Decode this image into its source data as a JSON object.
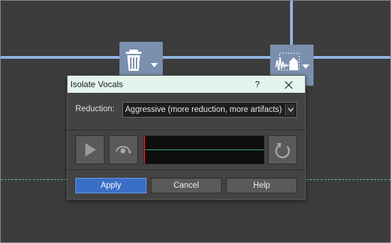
{
  "dialog": {
    "title": "Isolate Vocals",
    "help_glyph": "?",
    "close_icon": "close-icon"
  },
  "reduction": {
    "label": "Reduction:",
    "selected": "Aggressive (more reduction, more artifacts)"
  },
  "preview": {
    "play_icon": "play-icon",
    "preview_icon": "preview-toggle-icon",
    "loop_icon": "loop-icon"
  },
  "buttons": {
    "apply": "Apply",
    "cancel": "Cancel",
    "help": "Help"
  },
  "background": {
    "tools": [
      {
        "icon": "trash-icon"
      },
      {
        "icon": "waveform-icon"
      }
    ]
  },
  "colors": {
    "accent": "#3a6fc8",
    "titlebar": "#e3f4ec",
    "guide_lines": "#8fb3e0",
    "meter_cursor": "#c81e1e",
    "meter_baseline": "#3aa590"
  }
}
